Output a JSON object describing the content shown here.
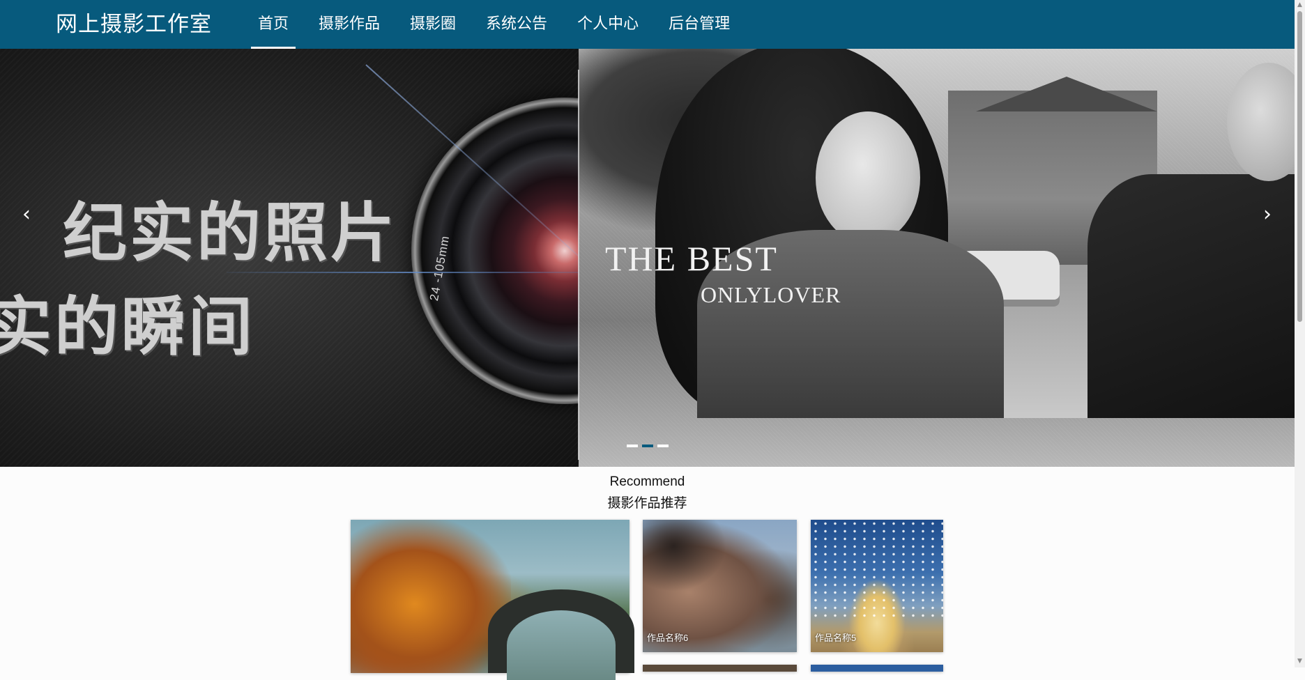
{
  "header": {
    "logo": "网上摄影工作室",
    "nav": [
      {
        "label": "首页",
        "active": true
      },
      {
        "label": "摄影作品",
        "active": false
      },
      {
        "label": "摄影圈",
        "active": false
      },
      {
        "label": "系统公告",
        "active": false
      },
      {
        "label": "个人中心",
        "active": false
      },
      {
        "label": "后台管理",
        "active": false
      }
    ],
    "background_color": "#075a7d"
  },
  "banner": {
    "text_cn_line1": "纪实的照片",
    "text_cn_line2": "实的瞬间",
    "lens_label": "24 -105mm",
    "text_en_line1": "THE BEST",
    "text_en_line2": "ONLYLOVER",
    "prev_arrow": "‹",
    "next_arrow": "›",
    "slide_count": 3,
    "active_slide": 2
  },
  "recommend": {
    "title": "Recommend",
    "subtitle": "摄影作品推荐",
    "cards": [
      {
        "label": ""
      },
      {
        "label": "作品名称6"
      },
      {
        "label": "作品名称5"
      }
    ]
  },
  "icons": {
    "prev": "chevron-left-icon",
    "next": "chevron-right-icon",
    "scroll_up": "▲",
    "scroll_down": "▼"
  }
}
